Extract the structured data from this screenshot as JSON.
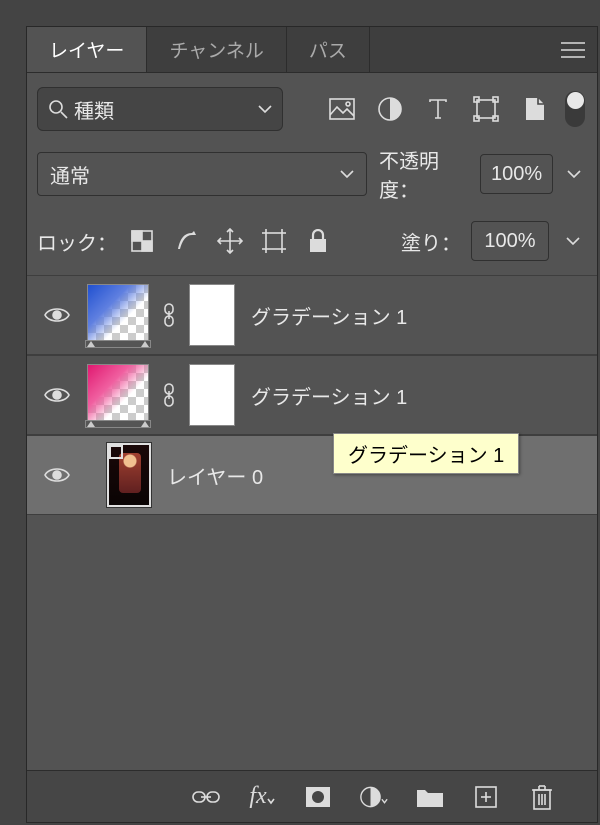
{
  "tabs": {
    "layers": "レイヤー",
    "channels": "チャンネル",
    "paths": "パス"
  },
  "search": {
    "placeholder": "種類"
  },
  "blend": {
    "mode": "通常",
    "opacity_label": "不透明度：",
    "opacity_value": "100%"
  },
  "lock": {
    "label": "ロック：",
    "fill_label": "塗り：",
    "fill_value": "100%"
  },
  "layers": [
    {
      "name": "グラデーション 1"
    },
    {
      "name": "グラデーション 1"
    },
    {
      "name": "レイヤー 0"
    }
  ],
  "tooltip": "グラデーション 1"
}
